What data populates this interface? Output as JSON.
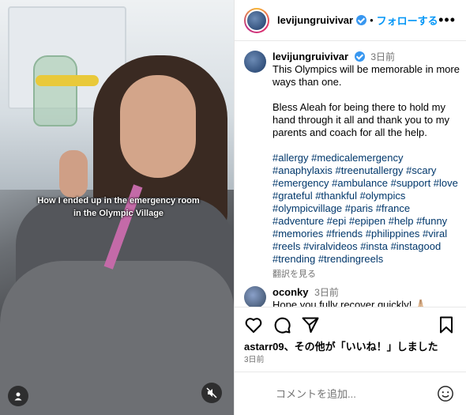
{
  "overlay": {
    "caption_line1": "How I ended up in the emergency room",
    "caption_line2": "in the Olympic Village"
  },
  "header": {
    "username": "levijungruivivar",
    "separator": "•",
    "follow_label": "フォローする",
    "more_label": "•••"
  },
  "post": {
    "username": "levijungruivivar",
    "time": "3日前",
    "paragraph1": "This Olympics will be memorable in more ways than one.",
    "paragraph2": "Bless Aleah for being there to hold my hand through it all and thank you to my parents and coach for all the help.",
    "hashtags": "#allergy #medicalemergency #anaphylaxis #treenutallergy #scary #emergency #ambulance #support #love #grateful #thankful #olympics #olympicvillage #paris #france #adventure #epi #epipen #help #funny #memories #friends #philippines #viral #reels #viralvideos #insta #instagood #trending #trendingreels",
    "translate_label": "翻訳を見る"
  },
  "comment": {
    "username": "oconky",
    "time": "3日前",
    "text": "Hope you fully recover quickly! 🙏🏼"
  },
  "likes": {
    "user": "astarr09",
    "suffix": "、その他が「いいね！」しました"
  },
  "date_label": "3日前",
  "comment_input": {
    "placeholder": "コメントを追加..."
  },
  "icons": {
    "like": "heart-icon",
    "comment": "comment-bubble-icon",
    "share": "paper-plane-icon",
    "save": "bookmark-icon",
    "emoji": "smiley-icon",
    "user": "user-tag-icon",
    "mute": "muted-speaker-icon"
  },
  "colors": {
    "link_blue": "#0095f6",
    "hashtag": "#00376b",
    "verified": "#3897f0",
    "muted_text": "#737373"
  }
}
